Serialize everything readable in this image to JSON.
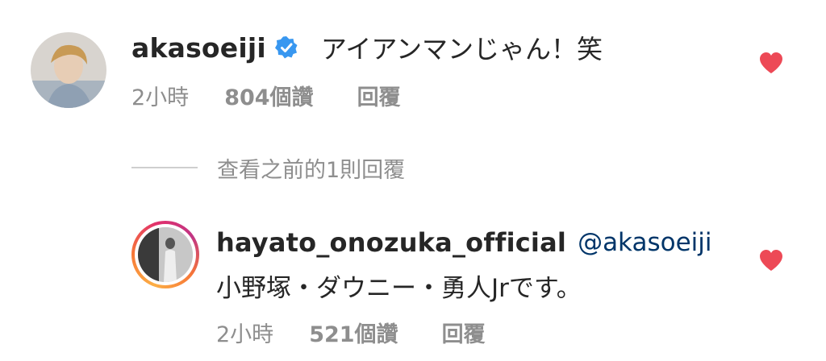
{
  "comment1": {
    "username": "akasoeiji",
    "verified": true,
    "text": "アイアンマンじゃん！笑",
    "time": "2小時",
    "likes": "804個讚",
    "reply": "回覆"
  },
  "view_replies": {
    "label": "查看之前的1則回覆"
  },
  "comment2": {
    "username": "hayato_onozuka_official",
    "mention": "@akasoeiji",
    "text": "小野塚・ダウニー・勇人Jrです。",
    "time": "2小時",
    "likes": "521個讚",
    "reply": "回覆"
  },
  "colors": {
    "heart": "#ed4956",
    "mention": "#003569",
    "muted": "#8e8e8e",
    "verified": "#3897f0"
  }
}
